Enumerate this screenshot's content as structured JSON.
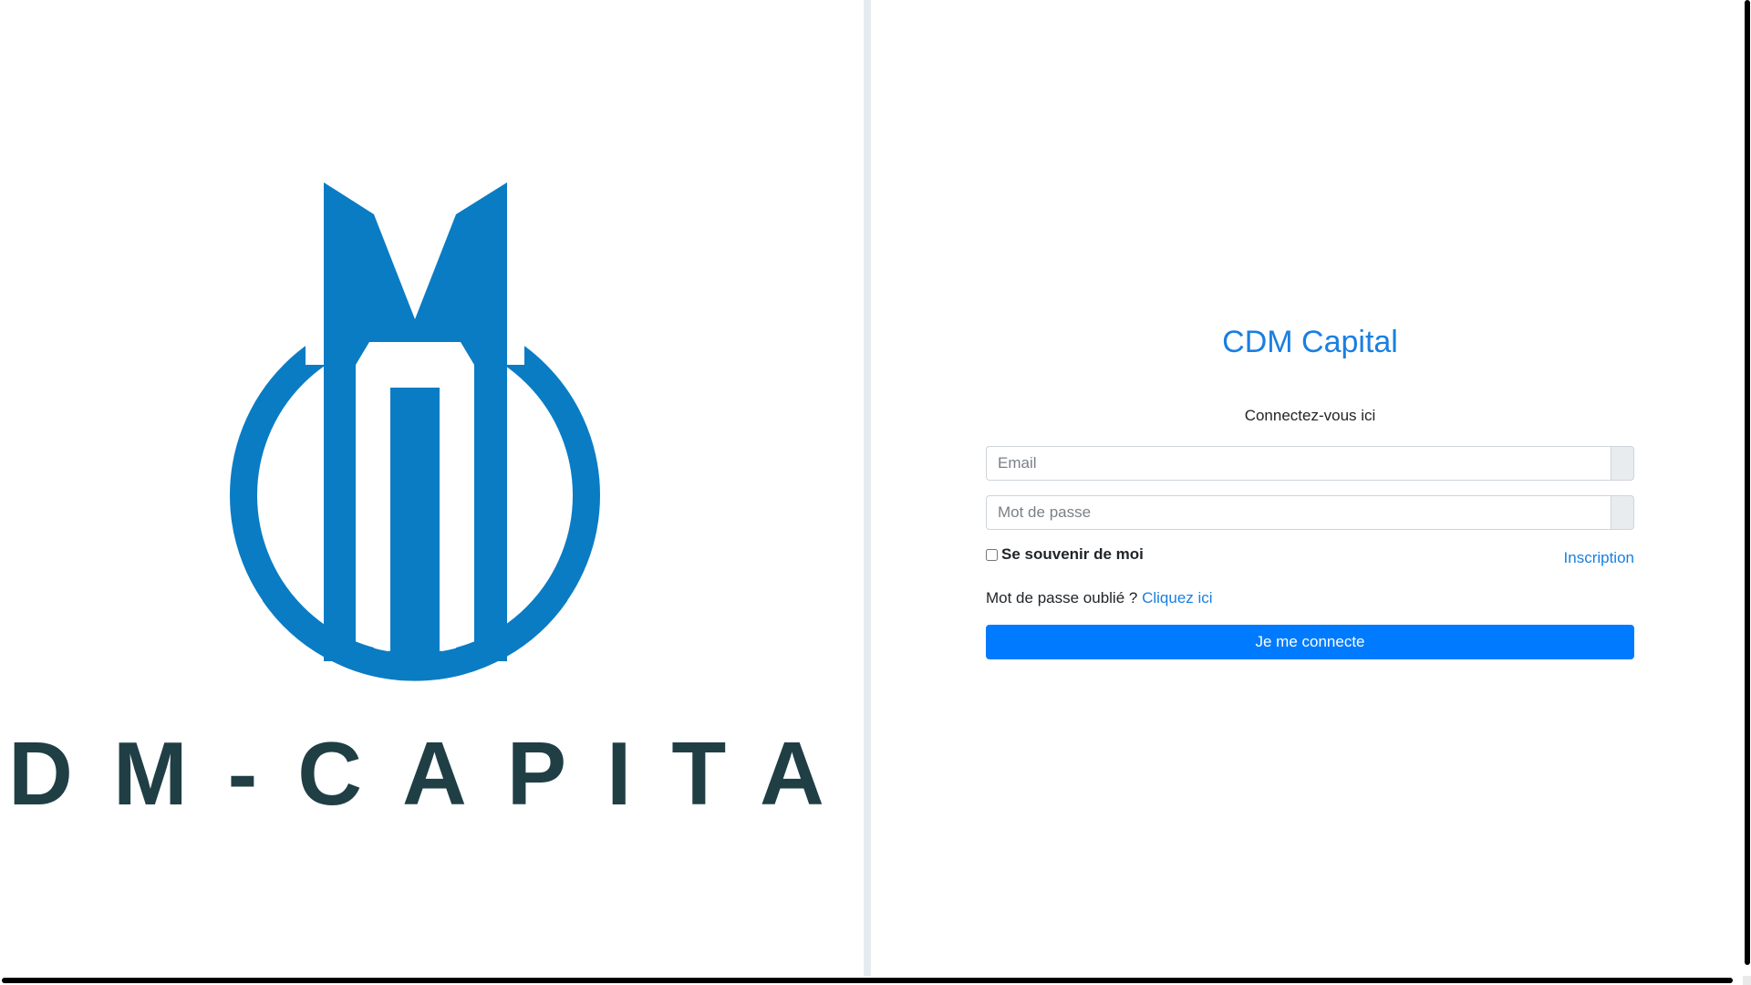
{
  "logo": {
    "wordmark": "CDM-CAPITAL",
    "brand_color": "#0a7cc4",
    "wordmark_color": "#1f3f45"
  },
  "login": {
    "title": "CDM Capital",
    "subtitle": "Connectez-vous ici",
    "email_placeholder": "Email",
    "password_placeholder": "Mot de passe",
    "remember_label": "Se souvenir de moi",
    "register_link": "Inscription",
    "forgot_text": "Mot de passe oublié ?",
    "forgot_link": "Cliquez ici",
    "submit_label": "Je me connecte",
    "accent_color": "#007bff",
    "link_color": "#1a7fe0"
  }
}
